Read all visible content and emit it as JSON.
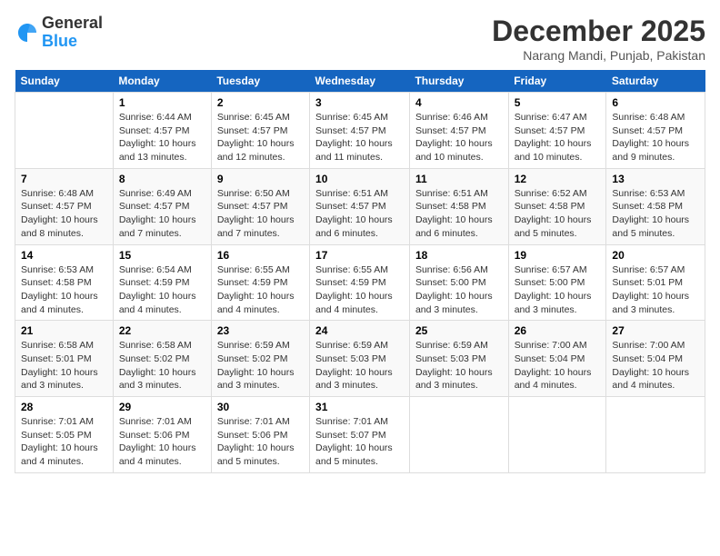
{
  "header": {
    "logo_general": "General",
    "logo_blue": "Blue",
    "month_title": "December 2025",
    "location": "Narang Mandi, Punjab, Pakistan"
  },
  "weekdays": [
    "Sunday",
    "Monday",
    "Tuesday",
    "Wednesday",
    "Thursday",
    "Friday",
    "Saturday"
  ],
  "weeks": [
    [
      {
        "day": "",
        "sunrise": "",
        "sunset": "",
        "daylight": ""
      },
      {
        "day": "1",
        "sunrise": "Sunrise: 6:44 AM",
        "sunset": "Sunset: 4:57 PM",
        "daylight": "Daylight: 10 hours and 13 minutes."
      },
      {
        "day": "2",
        "sunrise": "Sunrise: 6:45 AM",
        "sunset": "Sunset: 4:57 PM",
        "daylight": "Daylight: 10 hours and 12 minutes."
      },
      {
        "day": "3",
        "sunrise": "Sunrise: 6:45 AM",
        "sunset": "Sunset: 4:57 PM",
        "daylight": "Daylight: 10 hours and 11 minutes."
      },
      {
        "day": "4",
        "sunrise": "Sunrise: 6:46 AM",
        "sunset": "Sunset: 4:57 PM",
        "daylight": "Daylight: 10 hours and 10 minutes."
      },
      {
        "day": "5",
        "sunrise": "Sunrise: 6:47 AM",
        "sunset": "Sunset: 4:57 PM",
        "daylight": "Daylight: 10 hours and 10 minutes."
      },
      {
        "day": "6",
        "sunrise": "Sunrise: 6:48 AM",
        "sunset": "Sunset: 4:57 PM",
        "daylight": "Daylight: 10 hours and 9 minutes."
      }
    ],
    [
      {
        "day": "7",
        "sunrise": "Sunrise: 6:48 AM",
        "sunset": "Sunset: 4:57 PM",
        "daylight": "Daylight: 10 hours and 8 minutes."
      },
      {
        "day": "8",
        "sunrise": "Sunrise: 6:49 AM",
        "sunset": "Sunset: 4:57 PM",
        "daylight": "Daylight: 10 hours and 7 minutes."
      },
      {
        "day": "9",
        "sunrise": "Sunrise: 6:50 AM",
        "sunset": "Sunset: 4:57 PM",
        "daylight": "Daylight: 10 hours and 7 minutes."
      },
      {
        "day": "10",
        "sunrise": "Sunrise: 6:51 AM",
        "sunset": "Sunset: 4:57 PM",
        "daylight": "Daylight: 10 hours and 6 minutes."
      },
      {
        "day": "11",
        "sunrise": "Sunrise: 6:51 AM",
        "sunset": "Sunset: 4:58 PM",
        "daylight": "Daylight: 10 hours and 6 minutes."
      },
      {
        "day": "12",
        "sunrise": "Sunrise: 6:52 AM",
        "sunset": "Sunset: 4:58 PM",
        "daylight": "Daylight: 10 hours and 5 minutes."
      },
      {
        "day": "13",
        "sunrise": "Sunrise: 6:53 AM",
        "sunset": "Sunset: 4:58 PM",
        "daylight": "Daylight: 10 hours and 5 minutes."
      }
    ],
    [
      {
        "day": "14",
        "sunrise": "Sunrise: 6:53 AM",
        "sunset": "Sunset: 4:58 PM",
        "daylight": "Daylight: 10 hours and 4 minutes."
      },
      {
        "day": "15",
        "sunrise": "Sunrise: 6:54 AM",
        "sunset": "Sunset: 4:59 PM",
        "daylight": "Daylight: 10 hours and 4 minutes."
      },
      {
        "day": "16",
        "sunrise": "Sunrise: 6:55 AM",
        "sunset": "Sunset: 4:59 PM",
        "daylight": "Daylight: 10 hours and 4 minutes."
      },
      {
        "day": "17",
        "sunrise": "Sunrise: 6:55 AM",
        "sunset": "Sunset: 4:59 PM",
        "daylight": "Daylight: 10 hours and 4 minutes."
      },
      {
        "day": "18",
        "sunrise": "Sunrise: 6:56 AM",
        "sunset": "Sunset: 5:00 PM",
        "daylight": "Daylight: 10 hours and 3 minutes."
      },
      {
        "day": "19",
        "sunrise": "Sunrise: 6:57 AM",
        "sunset": "Sunset: 5:00 PM",
        "daylight": "Daylight: 10 hours and 3 minutes."
      },
      {
        "day": "20",
        "sunrise": "Sunrise: 6:57 AM",
        "sunset": "Sunset: 5:01 PM",
        "daylight": "Daylight: 10 hours and 3 minutes."
      }
    ],
    [
      {
        "day": "21",
        "sunrise": "Sunrise: 6:58 AM",
        "sunset": "Sunset: 5:01 PM",
        "daylight": "Daylight: 10 hours and 3 minutes."
      },
      {
        "day": "22",
        "sunrise": "Sunrise: 6:58 AM",
        "sunset": "Sunset: 5:02 PM",
        "daylight": "Daylight: 10 hours and 3 minutes."
      },
      {
        "day": "23",
        "sunrise": "Sunrise: 6:59 AM",
        "sunset": "Sunset: 5:02 PM",
        "daylight": "Daylight: 10 hours and 3 minutes."
      },
      {
        "day": "24",
        "sunrise": "Sunrise: 6:59 AM",
        "sunset": "Sunset: 5:03 PM",
        "daylight": "Daylight: 10 hours and 3 minutes."
      },
      {
        "day": "25",
        "sunrise": "Sunrise: 6:59 AM",
        "sunset": "Sunset: 5:03 PM",
        "daylight": "Daylight: 10 hours and 3 minutes."
      },
      {
        "day": "26",
        "sunrise": "Sunrise: 7:00 AM",
        "sunset": "Sunset: 5:04 PM",
        "daylight": "Daylight: 10 hours and 4 minutes."
      },
      {
        "day": "27",
        "sunrise": "Sunrise: 7:00 AM",
        "sunset": "Sunset: 5:04 PM",
        "daylight": "Daylight: 10 hours and 4 minutes."
      }
    ],
    [
      {
        "day": "28",
        "sunrise": "Sunrise: 7:01 AM",
        "sunset": "Sunset: 5:05 PM",
        "daylight": "Daylight: 10 hours and 4 minutes."
      },
      {
        "day": "29",
        "sunrise": "Sunrise: 7:01 AM",
        "sunset": "Sunset: 5:06 PM",
        "daylight": "Daylight: 10 hours and 4 minutes."
      },
      {
        "day": "30",
        "sunrise": "Sunrise: 7:01 AM",
        "sunset": "Sunset: 5:06 PM",
        "daylight": "Daylight: 10 hours and 5 minutes."
      },
      {
        "day": "31",
        "sunrise": "Sunrise: 7:01 AM",
        "sunset": "Sunset: 5:07 PM",
        "daylight": "Daylight: 10 hours and 5 minutes."
      },
      {
        "day": "",
        "sunrise": "",
        "sunset": "",
        "daylight": ""
      },
      {
        "day": "",
        "sunrise": "",
        "sunset": "",
        "daylight": ""
      },
      {
        "day": "",
        "sunrise": "",
        "sunset": "",
        "daylight": ""
      }
    ]
  ]
}
